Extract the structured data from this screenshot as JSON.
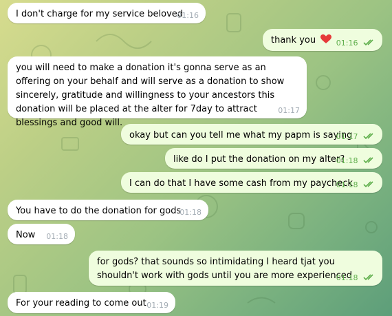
{
  "colors": {
    "incoming_bubble": "#ffffff",
    "outgoing_bubble": "#effdde",
    "incoming_time": "#a3acb4",
    "outgoing_time": "#5eae4b",
    "heart": "#e63a3a"
  },
  "icons": {
    "read_receipt": "double-check-icon",
    "emoji": "red-heart-icon"
  },
  "messages": [
    {
      "direction": "in",
      "text": "I don't charge for my service beloved",
      "time": "01:16"
    },
    {
      "direction": "out",
      "text": "thank you",
      "time": "01:16",
      "read": true
    },
    {
      "direction": "in",
      "text": "you will need to make a donation it's gonna serve as an offering on your behalf and will serve as a donation to show sincerely, gratitude and willingness to your ancestors this donation will be placed at the alter for 7day to attract blessings and good will.",
      "time": "01:17"
    },
    {
      "direction": "out",
      "text": "okay but can you tell me what my papm is saying",
      "time": "01:17",
      "read": true
    },
    {
      "direction": "out",
      "text": "like do I put the donation on my alter?",
      "time": "01:18",
      "read": true
    },
    {
      "direction": "out",
      "text": "I can do that I have some cash from my paycheck",
      "time": "01:18",
      "read": true
    },
    {
      "direction": "in",
      "text": "You have to do the donation for gods",
      "time": "01:18"
    },
    {
      "direction": "in",
      "text": "Now",
      "time": "01:18"
    },
    {
      "direction": "out",
      "text": "for gods? that sounds so intimidating I heard tjat you shouldn't work with gods until you are more experienced",
      "time": "01:18",
      "read": true
    },
    {
      "direction": "in",
      "text": "For your reading to come out",
      "time": "01:19"
    }
  ]
}
